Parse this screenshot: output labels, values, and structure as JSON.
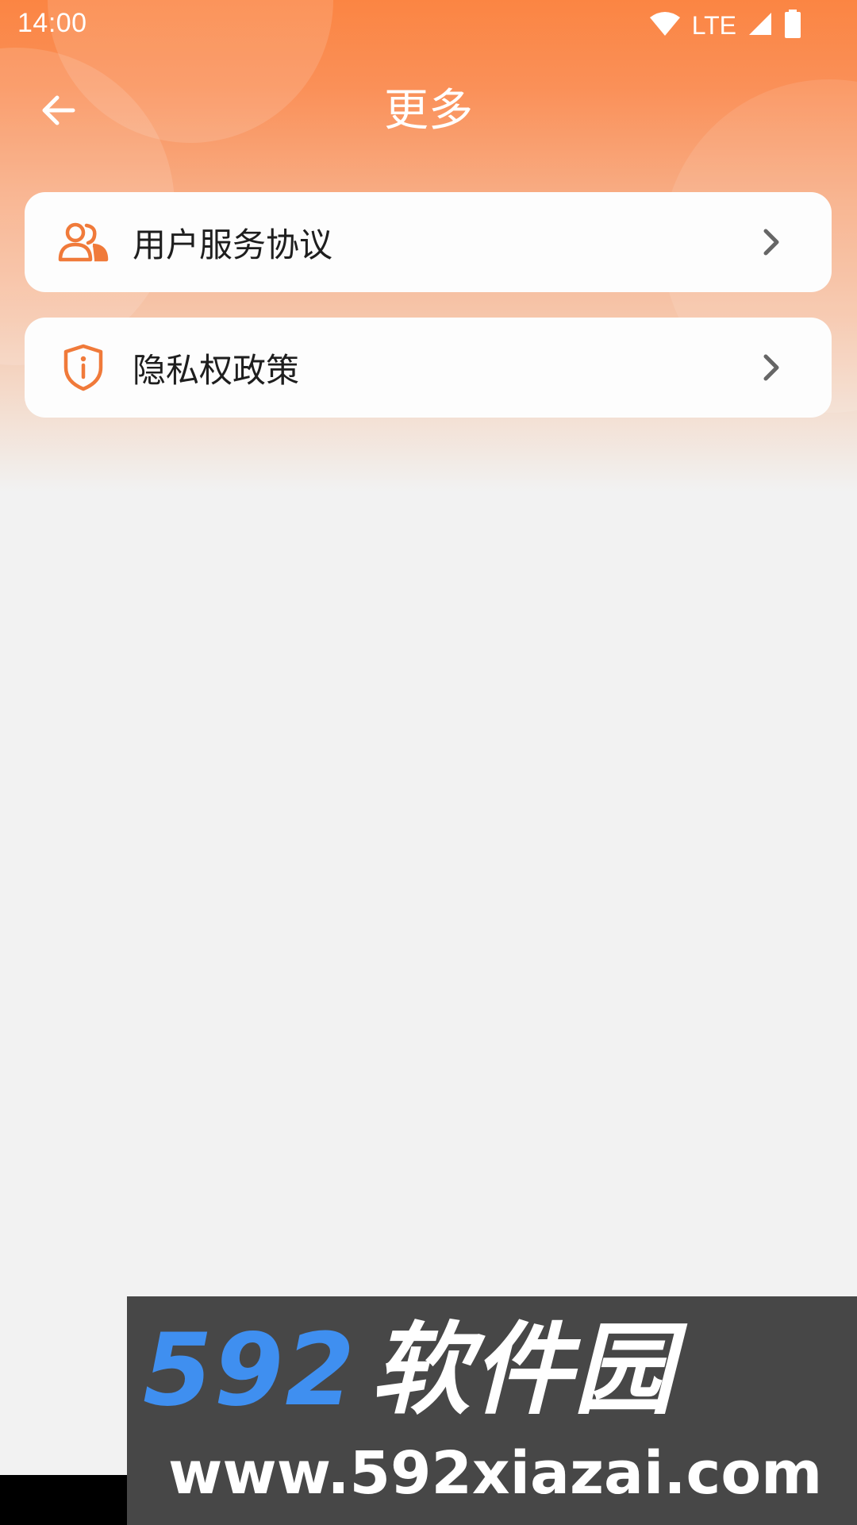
{
  "status_bar": {
    "time": "14:00",
    "network": "LTE",
    "icons": [
      "wifi-icon",
      "cellular-signal-icon",
      "battery-icon"
    ]
  },
  "header": {
    "title": "更多",
    "back_icon": "back-arrow-icon"
  },
  "menu": {
    "items": [
      {
        "label": "用户服务协议",
        "icon": "users-icon",
        "trailing_icon": "chevron-right-icon"
      },
      {
        "label": "隐私权政策",
        "icon": "shield-info-icon",
        "trailing_icon": "chevron-right-icon"
      }
    ]
  },
  "watermark": {
    "brand_number": "592",
    "brand_text": "软件园",
    "url": "www.592xiazai.com"
  },
  "colors": {
    "accent": "#fb8543",
    "icon_orange": "#f07a3a",
    "chevron": "#666666",
    "background": "#f2f2f2",
    "card": "#fdfdfd",
    "watermark_blue": "#3f8ff0",
    "watermark_bg": "#474747"
  }
}
